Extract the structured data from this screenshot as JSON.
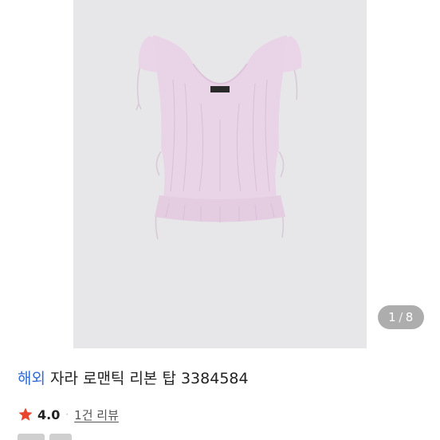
{
  "gallery": {
    "page_current": "1",
    "page_total": "8",
    "page_separator": "/",
    "image_subject": "lavender-ruffled-top"
  },
  "product": {
    "origin_tag": "해외",
    "title": "자라 로맨틱 리본 탑 3384584"
  },
  "rating": {
    "value": "4.0",
    "separator": "·",
    "review_link": "1건 리뷰",
    "star_color": "#e8452c"
  },
  "colors": {
    "photo_background": "#e7e6e9",
    "garment": "#e9d3e6",
    "origin_tag": "#2f6bd8"
  }
}
